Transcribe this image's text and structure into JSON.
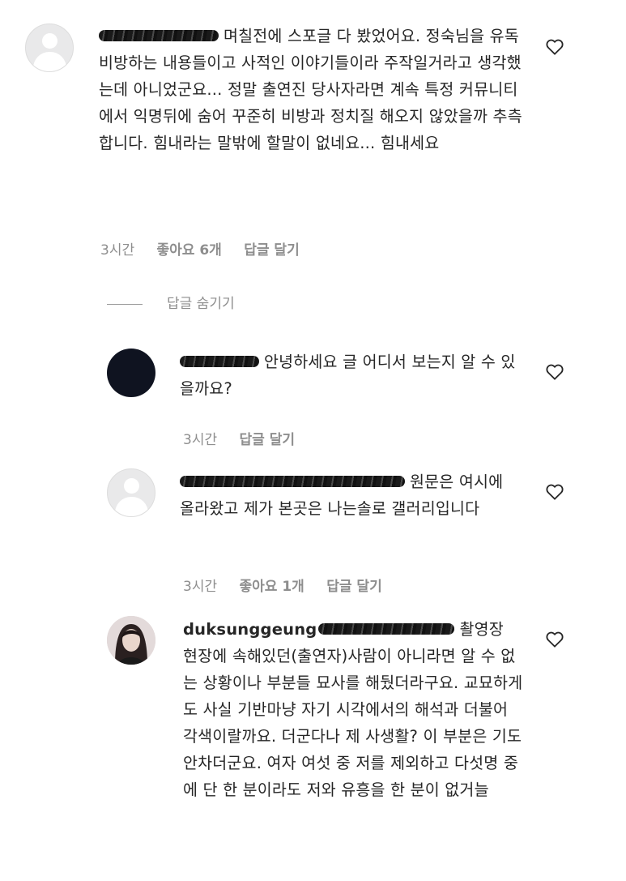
{
  "comments": [
    {
      "text": "며칠전에 스포글 다 봤었어요. 정숙님을 유독 비방하는 내용들이고 사적인 이야기들이라 주작일거라고 생각했는데 아니었군요... 정말 출연진 당사자라면 계속 특정 커뮤니티에서 익명뒤에 숨어 꾸준히 비방과 정치질 해오지 않았을까 추측합니다. 힘내라는 말밖에 할말이 없네요... 힘내세요",
      "time": "3시간",
      "likes": "좋아요 6개",
      "reply": "답글 달기"
    }
  ],
  "hide_replies": "답글 숨기기",
  "replies": [
    {
      "text": "안녕하세요 글 어디서 보는지 알 수 있을까요?",
      "time": "3시간",
      "reply": "답글 달기"
    },
    {
      "text": "원문은 여시에 올라왔고 제가 본곳은 나는솔로 갤러리입니다",
      "time": "3시간",
      "likes": "좋아요 1개",
      "reply": "답글 달기"
    },
    {
      "username": "duksunggeung",
      "text": "촬영장 현장에 속해있던(출연자)사람이 아니라면 알 수 없는 상황이나 부분들 묘사를 해뒀더라구요. 교묘하게도 사실 기반마냥 자기 시각에서의 해석과 더불어 각색이랄까요. 더군다나 제 사생활? 이 부분은 기도 안차더군요. 여자 여섯 중 저를 제외하고 다섯명 중에 단 한 분이라도 저와 유흥을 한 분이 없거늘"
    }
  ]
}
